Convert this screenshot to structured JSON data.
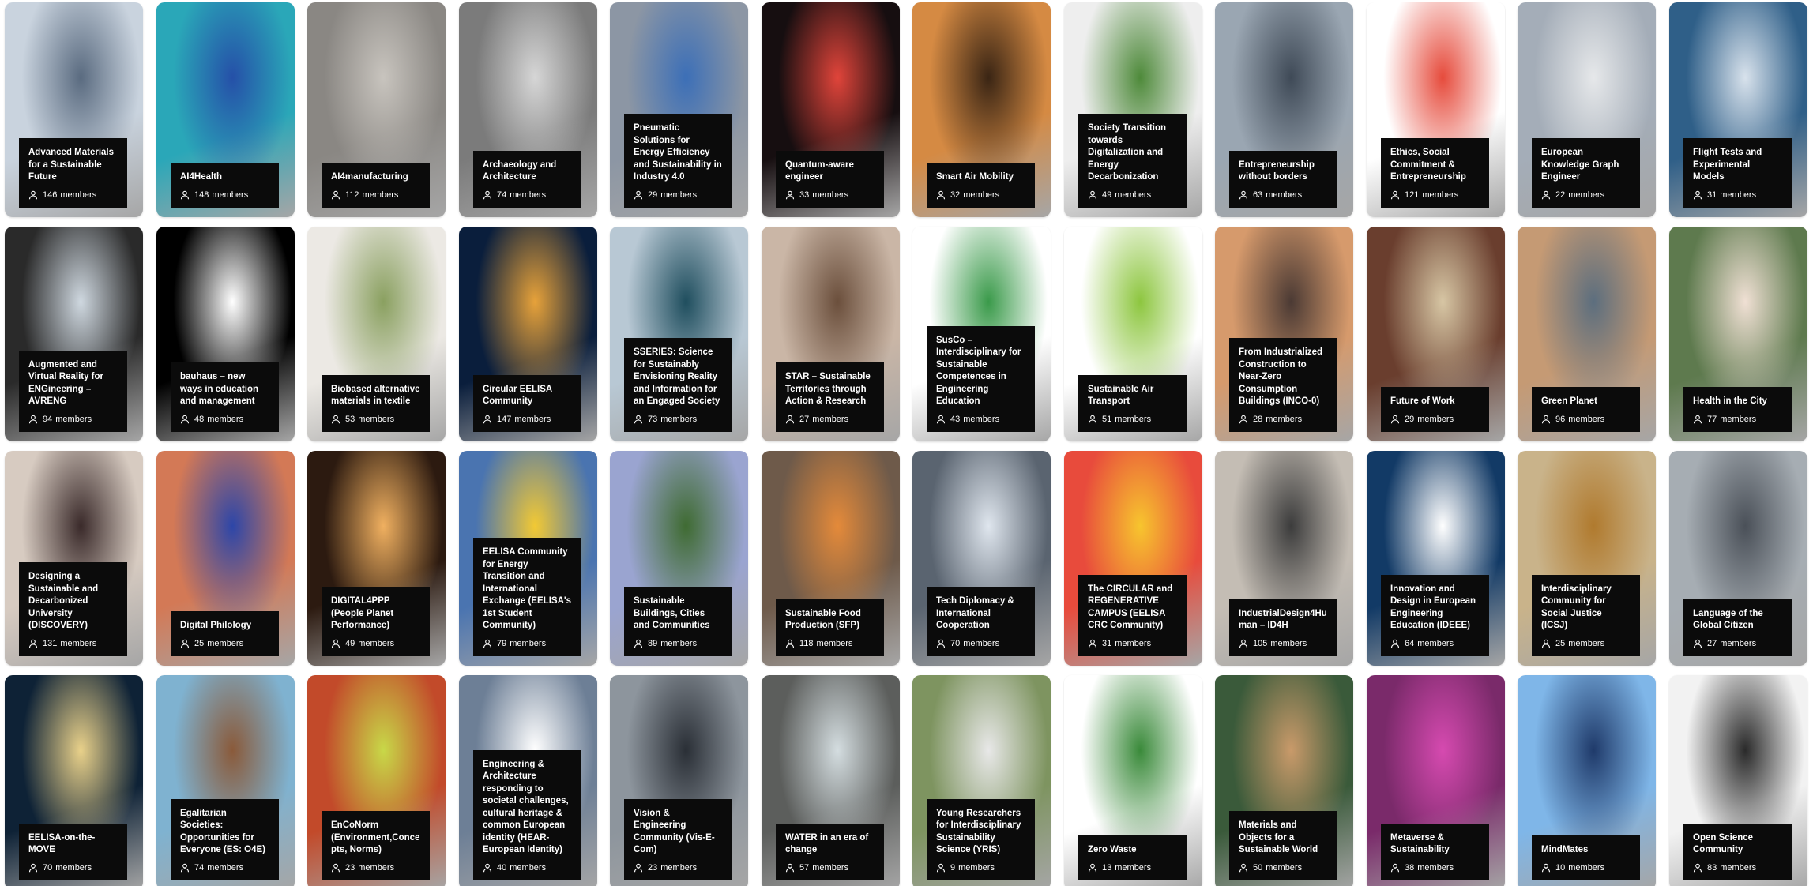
{
  "members_label": "members",
  "cards": [
    {
      "title": "Advanced Materials for a Sustainable Future",
      "members": 146,
      "bg": "#c9d3de",
      "accent": "#5a6b80",
      "icon": "robot-arm-photo"
    },
    {
      "title": "AI4Health",
      "members": 148,
      "bg": "#2aa7b8",
      "accent": "#2550a8",
      "icon": "robot-hand-photo"
    },
    {
      "title": "AI4manufacturing",
      "members": 112,
      "bg": "#8a8783",
      "accent": "#c8c4be",
      "icon": "car-factory-photo"
    },
    {
      "title": "Archaeology and Architecture",
      "members": 74,
      "bg": "#7b7b7b",
      "accent": "#d6d6d6",
      "icon": "ruins-photo"
    },
    {
      "title": "Pneumatic Solutions for Energy Efficiency and Sustainability in Industry 4.0",
      "members": 29,
      "bg": "#8c96a4",
      "accent": "#3c6fb7",
      "icon": "pneumatics-photo"
    },
    {
      "title": "Quantum-aware engineer",
      "members": 33,
      "bg": "#160e10",
      "accent": "#e0443a",
      "icon": "laser-photo"
    },
    {
      "title": "Smart Air Mobility",
      "members": 32,
      "bg": "#d58a43",
      "accent": "#3a2514",
      "icon": "drone-sunset-photo"
    },
    {
      "title": "Society Transition towards Digitalization and Energy Decarbonization",
      "members": 49,
      "bg": "#eeeeee",
      "accent": "#4e8a3a",
      "icon": "leaf-laptop-photo"
    },
    {
      "title": "Entrepreneurship without borders",
      "members": 63,
      "bg": "#9aa6b2",
      "accent": "#3f4a57",
      "icon": "office-photo"
    },
    {
      "title": "Ethics, Social Commitment & Entrepreneurship",
      "members": 121,
      "bg": "#ffffff",
      "accent": "#e64b3c",
      "icon": "esce-logo"
    },
    {
      "title": "European Knowledge Graph Engineer",
      "members": 22,
      "bg": "#a4adb8",
      "accent": "#e6e8ea",
      "icon": "lab-robot-photo"
    },
    {
      "title": "Flight Tests and Experimental Models",
      "members": 31,
      "bg": "#2f5f88",
      "accent": "#d8e2ec",
      "icon": "jet-trail-photo"
    },
    {
      "title": "Augmented and Virtual Reality for ENGineering – AVRENG",
      "members": 94,
      "bg": "#2a2a2a",
      "accent": "#cfd8e0",
      "icon": "vr-people-photo"
    },
    {
      "title": "bauhaus – new ways in education and management",
      "members": 48,
      "bg": "#000000",
      "accent": "#ffffff",
      "icon": "bauhaus-logo"
    },
    {
      "title": "Biobased alternative materials in textile",
      "members": 53,
      "bg": "#ece9e4",
      "accent": "#8aa060",
      "icon": "flowers-photo"
    },
    {
      "title": "Circular EELISA Community",
      "members": 147,
      "bg": "#0a1e3c",
      "accent": "#e7a23a",
      "icon": "roundabout-photo"
    },
    {
      "title": "SSERIES: Science for Sustainably Envisioning Reality and Information for an Engaged Society",
      "members": 73,
      "bg": "#b8c8d4",
      "accent": "#1f4e5e",
      "icon": "globe-photo"
    },
    {
      "title": "STAR – Sustainable Territories through Action & Research",
      "members": 27,
      "bg": "#cab6a6",
      "accent": "#6b4f3c",
      "icon": "team-photo"
    },
    {
      "title": "SusCo – Interdisciplinary for Sustainable Competences in Engineering Education",
      "members": 43,
      "bg": "#ffffff",
      "accent": "#3a9a4a",
      "icon": "gears-leaf-illustration"
    },
    {
      "title": "Sustainable Air Transport",
      "members": 51,
      "bg": "#ffffff",
      "accent": "#8dc63f",
      "icon": "airport-illustration"
    },
    {
      "title": "From Industrialized Construction to Near-Zero Consumption Buildings (INCO-0)",
      "members": 28,
      "bg": "#d69a6c",
      "accent": "#4b3a34",
      "icon": "crane-photo"
    },
    {
      "title": "Future of Work",
      "members": 29,
      "bg": "#6a3e2e",
      "accent": "#d7c6a4",
      "icon": "live-work-create-photo"
    },
    {
      "title": "Green Planet",
      "members": 96,
      "bg": "#c59a74",
      "accent": "#5c6e7e",
      "icon": "sky-photo"
    },
    {
      "title": "Health in the City",
      "members": 77,
      "bg": "#5e7a4e",
      "accent": "#f0e0d4",
      "icon": "nurse-patient-photo"
    },
    {
      "title": "Designing a Sustainable and Decarbonized University (DISCOVERY)",
      "members": 131,
      "bg": "#d7cbc1",
      "accent": "#3a2a2a",
      "icon": "students-photo"
    },
    {
      "title": "Digital Philology",
      "members": 25,
      "bg": "#d37956",
      "accent": "#2d46a8",
      "icon": "head-sculpture-photo"
    },
    {
      "title": "DIGITAL4PPP (People Planet Performance)",
      "members": 49,
      "bg": "#2c1a10",
      "accent": "#f0b060",
      "icon": "light-tunnel-photo"
    },
    {
      "title": "EELISA Community for Energy Transition and International Exchange (EELISA's 1st Student Community)",
      "members": 79,
      "bg": "#4a74b0",
      "accent": "#f2c934",
      "icon": "eu-tree-logo"
    },
    {
      "title": "Sustainable Buildings, Cities and Communities",
      "members": 89,
      "bg": "#9aa4d0",
      "accent": "#3f6b32",
      "icon": "green-tower-photo"
    },
    {
      "title": "Sustainable Food Production (SFP)",
      "members": 118,
      "bg": "#6e5a4a",
      "accent": "#e48a3a",
      "icon": "vegetables-photo"
    },
    {
      "title": "Tech Diplomacy & International Cooperation",
      "members": 70,
      "bg": "#5a6470",
      "accent": "#dfe6ee",
      "icon": "globe-hand-photo"
    },
    {
      "title": "The CIRCULAR and REGENERATIVE CAMPUS (EELISA CRC Community)",
      "members": 31,
      "bg": "#e84b3c",
      "accent": "#f7c52e",
      "icon": "paint-hands-photo"
    },
    {
      "title": "IndustrialDesign4Human – ID4H",
      "members": 105,
      "bg": "#c4bdb4",
      "accent": "#3c3c3c",
      "icon": "tablet-photo"
    },
    {
      "title": "Innovation and Design in European Engineering Education (IDEEE)",
      "members": 64,
      "bg": "#123a66",
      "accent": "#ffffff",
      "icon": "paper-plane-photo"
    },
    {
      "title": "Interdisciplinary Community for Social Justice (ICSJ)",
      "members": 25,
      "bg": "#c9b38a",
      "accent": "#b07a2e",
      "icon": "scales-photo"
    },
    {
      "title": "Language of the Global Citizen",
      "members": 27,
      "bg": "#a6adb3",
      "accent": "#4a5058",
      "icon": "laptop-hands-photo"
    },
    {
      "title": "EELISA-on-the-MOVE",
      "members": 70,
      "bg": "#0e2236",
      "accent": "#e9d18a",
      "icon": "star-trails-photo"
    },
    {
      "title": "Egalitarian Societies: Opportunities for Everyone (ES: O4E)",
      "members": 74,
      "bg": "#7fb2d0",
      "accent": "#8a5a3a",
      "icon": "hands-photo"
    },
    {
      "title": "EnCoNorm (Environment,Concepts, Norms)",
      "members": 23,
      "bg": "#c24a2a",
      "accent": "#c8d848",
      "icon": "leaf-photo"
    },
    {
      "title": "Engineering & Architecture responding to societal challenges, cultural heritage & common European identity (HEAR-European Identity)",
      "members": 40,
      "bg": "#6d7f96",
      "accent": "#ffffff",
      "icon": "eelisa-building-photo"
    },
    {
      "title": "Vision & Engineering Community (Vis-E-Com)",
      "members": 23,
      "bg": "#8d959d",
      "accent": "#2a2f36",
      "icon": "glasses-photo"
    },
    {
      "title": "WATER in an era of change",
      "members": 57,
      "bg": "#5c5e5c",
      "accent": "#d4dde0",
      "icon": "water-hands-photo"
    },
    {
      "title": "Young Researchers for Interdisciplinary Sustainability Science (YRIS)",
      "members": 9,
      "bg": "#7e9460",
      "accent": "#e8e8e8",
      "icon": "chairs-field-photo"
    },
    {
      "title": "Zero Waste",
      "members": 13,
      "bg": "#ffffff",
      "accent": "#3a8a3a",
      "icon": "zero-waste-illustration"
    },
    {
      "title": "Materials and Objects for a Sustainable World",
      "members": 50,
      "bg": "#3a5a3a",
      "accent": "#c99a6a",
      "icon": "coffee-cup-photo"
    },
    {
      "title": "Metaverse & Sustainability",
      "members": 38,
      "bg": "#7a2a6a",
      "accent": "#d64ab0",
      "icon": "metaverse-photo"
    },
    {
      "title": "MindMates",
      "members": 10,
      "bg": "#7fb6e8",
      "accent": "#1f3a6a",
      "icon": "mind-mates-logo"
    },
    {
      "title": "Open Science Community",
      "members": 83,
      "bg": "#f2f2f2",
      "accent": "#2a2a2a",
      "icon": "microscope-photo"
    }
  ]
}
